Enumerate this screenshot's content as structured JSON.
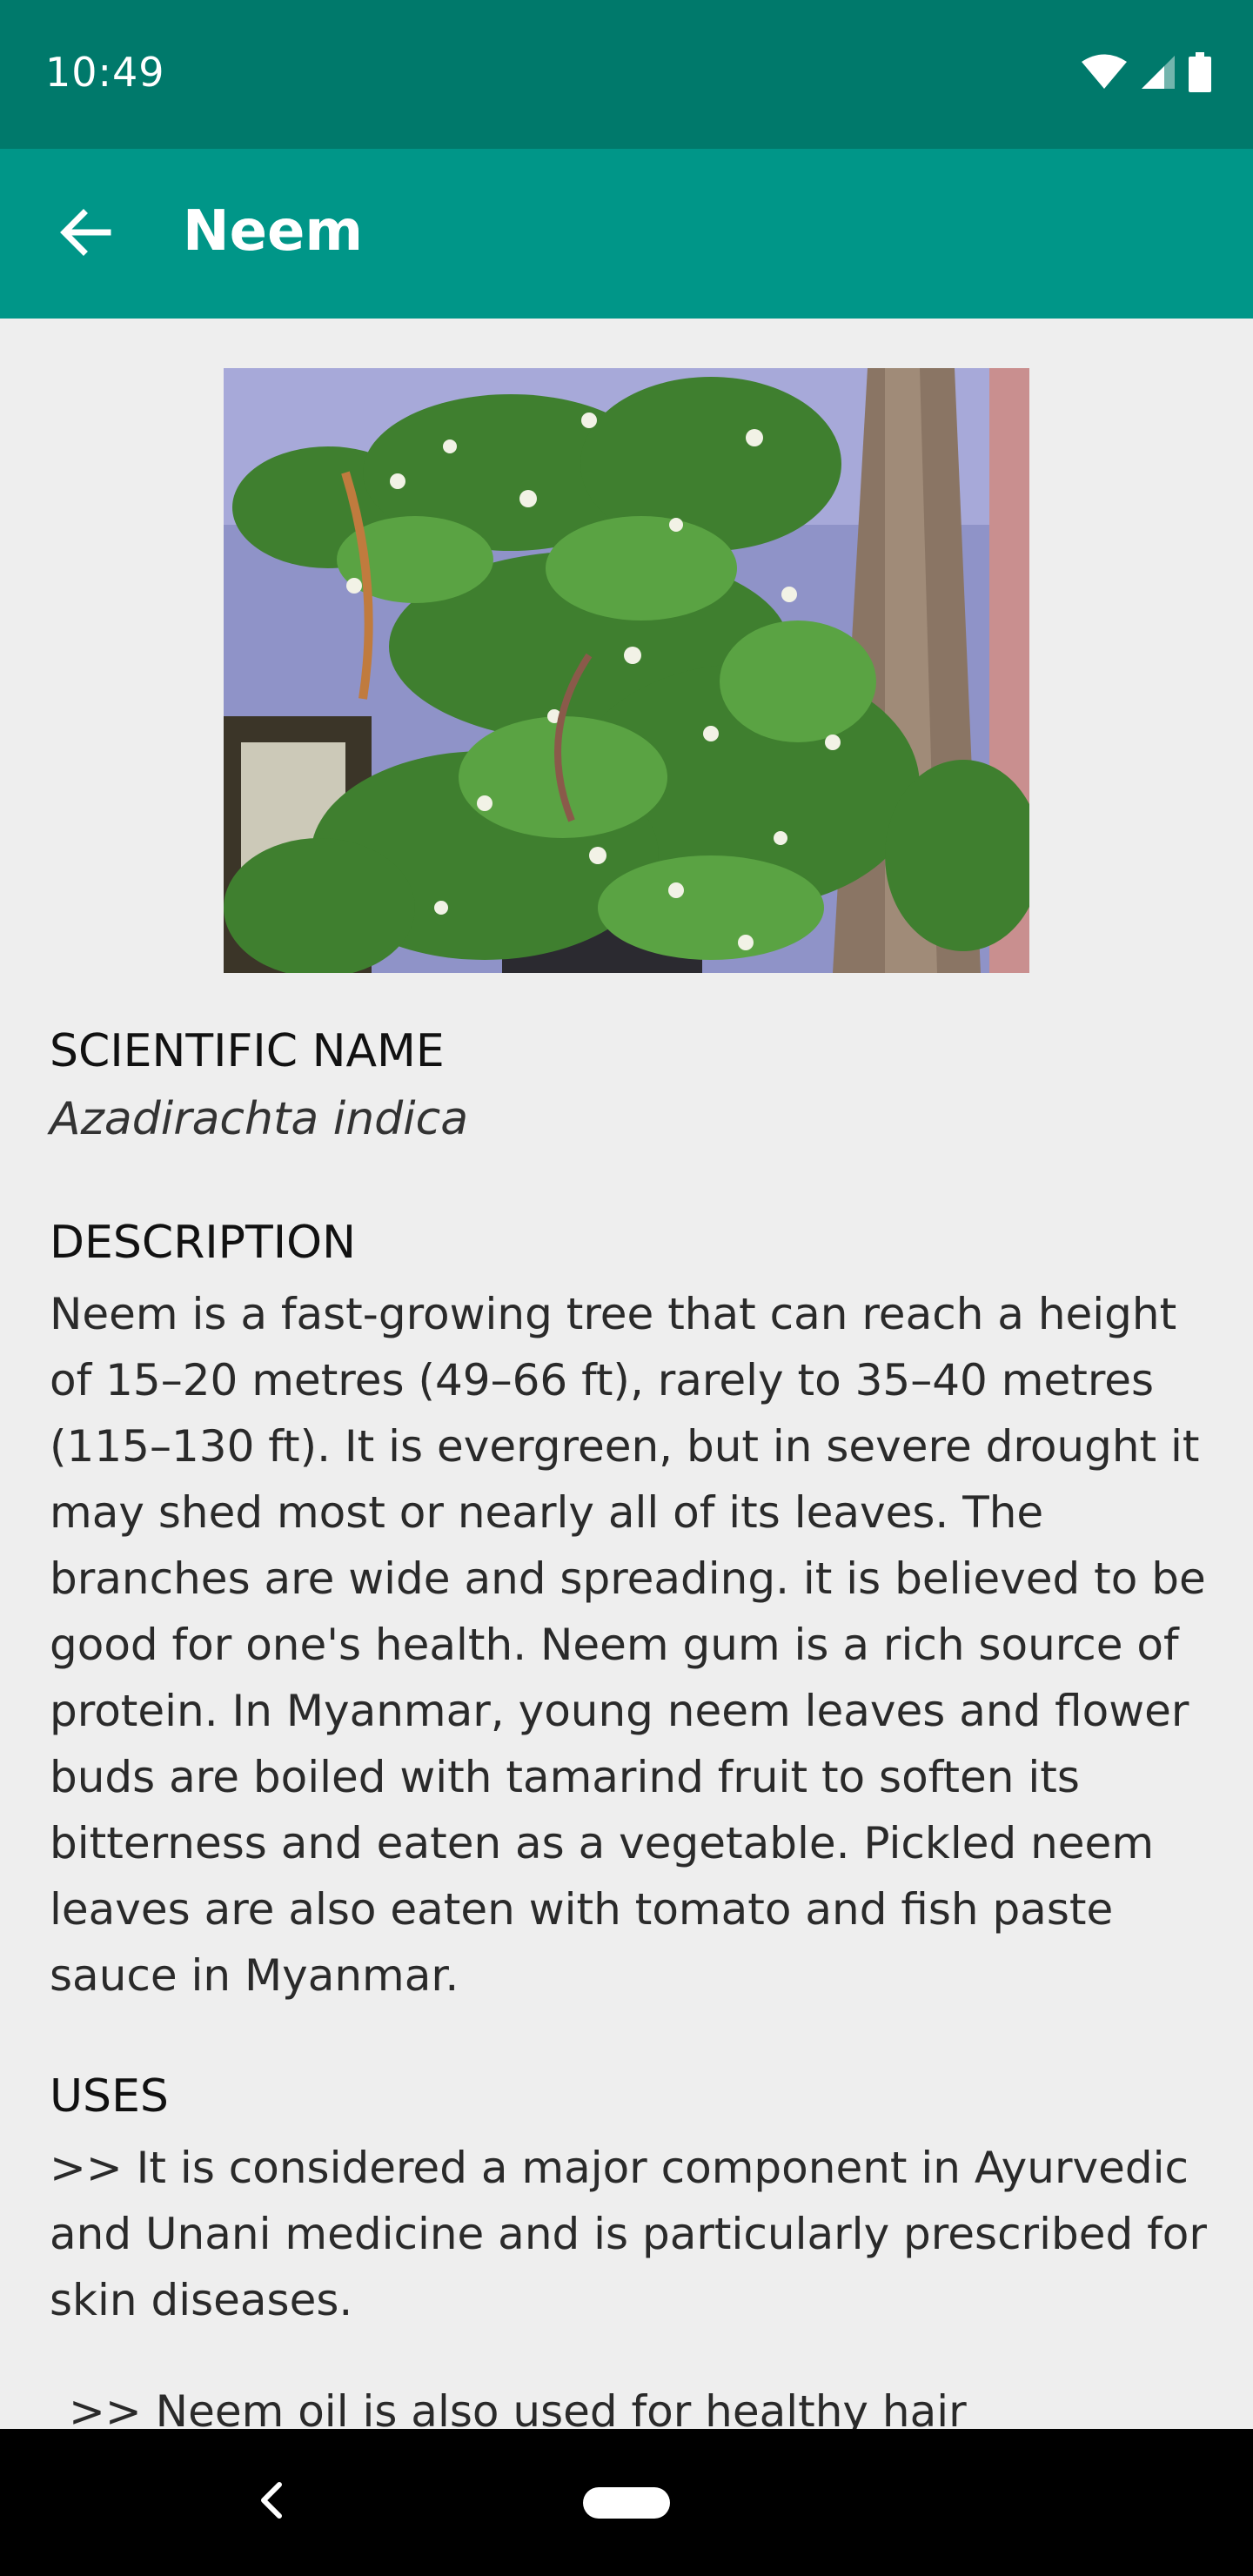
{
  "status_bar": {
    "time": "10:49",
    "icons": [
      "wifi-icon",
      "signal-icon",
      "battery-icon"
    ],
    "background": "#00796b"
  },
  "app_bar": {
    "title": "Neem",
    "back_icon": "arrow-back-icon",
    "background": "#009688"
  },
  "image": {
    "description_icon": "neem-tree-photo"
  },
  "sections": {
    "scientific_name": {
      "heading": "SCIENTIFIC NAME",
      "value": "Azadirachta indica"
    },
    "description": {
      "heading": "DESCRIPTION",
      "text": "Neem is a fast-growing tree that can reach a height of 15–20 metres (49–66 ft), rarely to 35–40 metres (115–130 ft). It is evergreen, but in severe drought it may shed most or nearly all of its leaves. The branches are wide and spreading. it is believed to be good for one's health. Neem gum is a rich source of protein. In Myanmar, young neem leaves and flower buds are boiled with tamarind fruit to soften its bitterness and eaten as a vegetable. Pickled neem leaves are also eaten with tomato and fish paste sauce in Myanmar."
    },
    "uses": {
      "heading": "USES",
      "items": [
        ">> It is considered a major component in Ayurvedic  and Unani medicine and is particularly prescribed for skin diseases.",
        ">> Neem oil is also used for healthy hair"
      ]
    }
  },
  "nav_bar": {
    "back_icon": "nav-back-icon",
    "home_icon": "home-pill-icon"
  }
}
